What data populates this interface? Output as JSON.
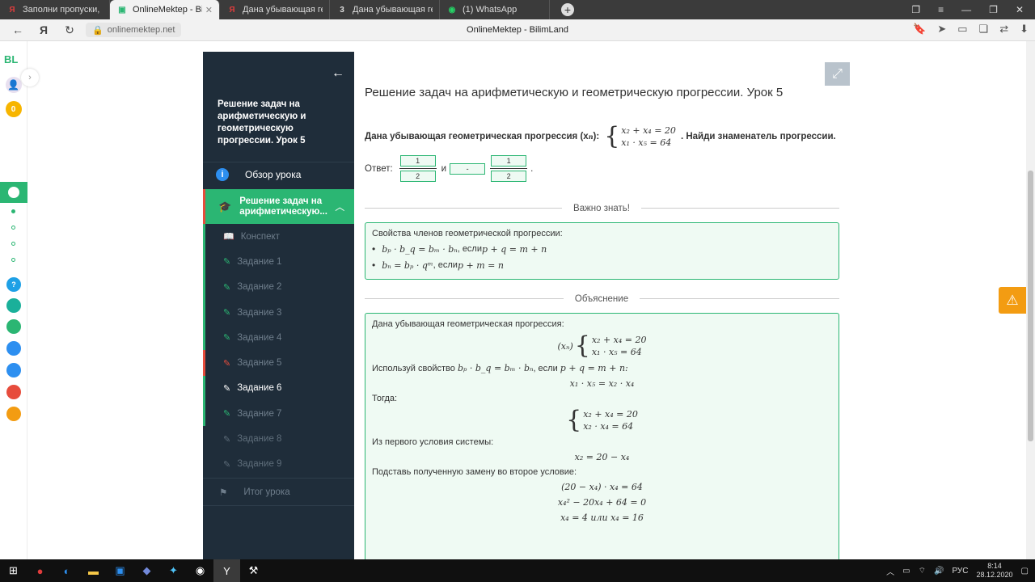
{
  "browser": {
    "tabs": [
      {
        "icon": "Я",
        "title": "Заполни пропуски, выбр",
        "icon_color": "#e03c3c"
      },
      {
        "icon": "▣",
        "title": "OnlineMektep - BilimLa",
        "icon_color": "#2bb673",
        "active": true
      },
      {
        "icon": "Я",
        "title": "Дана убывающая геомет",
        "icon_color": "#e03c3c"
      },
      {
        "icon": "3",
        "title": "Дана убывающая геомет",
        "icon_color": "#ffffff"
      },
      {
        "icon": "◉",
        "title": "(1) WhatsApp",
        "icon_color": "#25d366"
      }
    ],
    "url": "onlinemektep.net",
    "page_title": "OnlineMektep - BilimLand"
  },
  "rail": {
    "logo": "BL",
    "badge": "0"
  },
  "sidebar": {
    "lesson_title": "Решение задач на арифметическую и геометрическую прогрессии. Урок 5",
    "overview_label": "Обзор урока",
    "section_label": "Решение задач на арифметическую...",
    "items": [
      {
        "label": "Конспект",
        "kind": "book"
      },
      {
        "label": "Задание 1",
        "kind": "done"
      },
      {
        "label": "Задание 2",
        "kind": "done"
      },
      {
        "label": "Задание 3",
        "kind": "done"
      },
      {
        "label": "Задание 4",
        "kind": "done"
      },
      {
        "label": "Задание 5",
        "kind": "wrong"
      },
      {
        "label": "Задание 6",
        "kind": "current"
      },
      {
        "label": "Задание 7",
        "kind": "done"
      },
      {
        "label": "Задание 8",
        "kind": "locked"
      },
      {
        "label": "Задание 9",
        "kind": "locked"
      }
    ],
    "summary_label": "Итог урока"
  },
  "content": {
    "heading": "Решение задач на арифметическую и геометрическую прогрессии. Урок 5",
    "task_prefix": "Дана убывающая геометрическая прогрессия (x",
    "task_sub": "n",
    "task_suffix": "):",
    "task_tail": ". Найди знаменатель прогрессии.",
    "system_line1": "x₂ + x₄ = 20",
    "system_line2": "x₁ · x₅ = 64",
    "answer_label": "Ответ:",
    "answer_frac1_num": "1",
    "answer_frac1_den": "2",
    "answer_and": "и",
    "answer_sign": "-",
    "answer_frac2_num": "1",
    "answer_frac2_den": "2",
    "answer_end": ".",
    "important_label": "Важно знать!",
    "properties_title": "Свойства членов геометрической прогрессии:",
    "property1_formula": "bₚ · b_q = bₘ · bₙ",
    "property1_cond": ", если ",
    "property1_eq": "p + q = m + n",
    "property2_formula": "bₙ = bₚ · qᵐ",
    "property2_cond": ", если ",
    "property2_eq": "p + m = n",
    "explanation_label": "Объяснение",
    "expl_intro": "Дана убывающая геометрическая прогрессия:",
    "expl_seq": "(xₙ)",
    "expl_use": "Используй свойство ",
    "expl_use_formula": "bₚ · b_q = bₘ · bₙ",
    "expl_use_cond": ", если ",
    "expl_use_eq": "p + q = m + n:",
    "expl_eq1": "x₁ · x₅ = x₂ · x₄",
    "expl_then": "Тогда:",
    "expl_sys2_line1": "x₂ + x₄ = 20",
    "expl_sys2_line2": "x₂ · x₄ = 64",
    "expl_from_first": "Из первого условия системы:",
    "expl_eq2": "x₂ = 20 − x₄",
    "expl_substitute": "Подставь полученную замену во второе условие:",
    "expl_eq3": "(20 − x₄) · x₄ = 64",
    "expl_eq4": "x₄² − 20x₄ + 64 = 0",
    "expl_eq5": "x₄ = 4 или x₄ = 16"
  },
  "taskbar": {
    "lang": "РУС",
    "time": "8:14",
    "date": "28.12.2020"
  }
}
